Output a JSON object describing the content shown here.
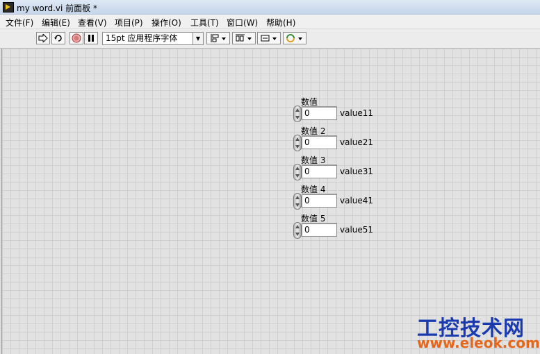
{
  "window": {
    "title": "my word.vi 前面板 *"
  },
  "menu": [
    "文件(F)",
    "编辑(E)",
    "查看(V)",
    "项目(P)",
    "操作(O)",
    "工具(T)",
    "窗口(W)",
    "帮助(H)"
  ],
  "toolbar": {
    "font_label": "15pt 应用程序字体",
    "icons": [
      "run-arrow-icon",
      "run-continuously-icon",
      "abort-icon",
      "pause-icon",
      "align-icon",
      "distribute-icon",
      "resize-icon",
      "reorder-icon"
    ]
  },
  "controls": [
    {
      "label": "数值",
      "value": "0",
      "side_label": "value11"
    },
    {
      "label": "数值 2",
      "value": "0",
      "side_label": "value21"
    },
    {
      "label": "数值 3",
      "value": "0",
      "side_label": "value31"
    },
    {
      "label": "数值 4",
      "value": "0",
      "side_label": "value41"
    },
    {
      "label": "数值 5",
      "value": "0",
      "side_label": "value51"
    }
  ],
  "watermark": {
    "line1": "工控技术网",
    "line2": "www.eleok.com"
  }
}
